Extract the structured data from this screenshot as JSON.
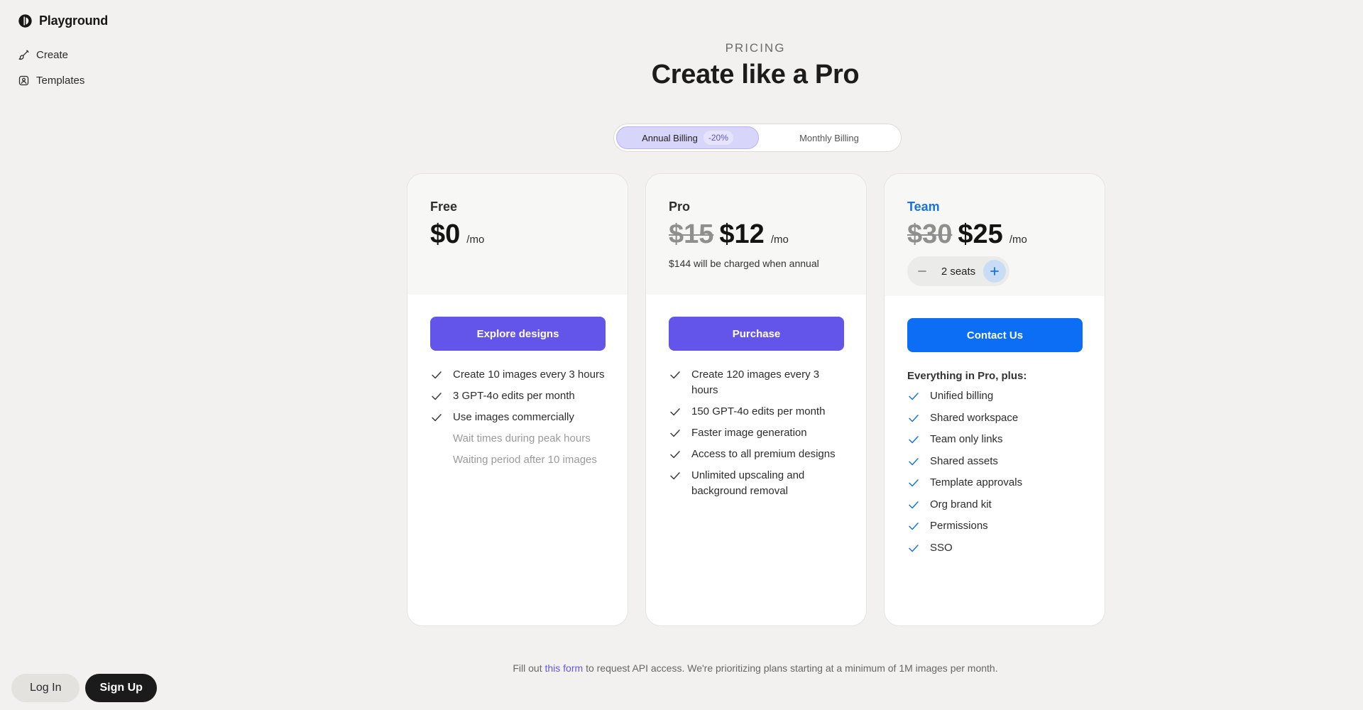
{
  "app": {
    "name": "Playground"
  },
  "sidebar": {
    "items": [
      {
        "label": "Create",
        "icon": "brush-icon"
      },
      {
        "label": "Templates",
        "icon": "templates-icon"
      }
    ],
    "auth": {
      "login_label": "Log In",
      "signup_label": "Sign Up"
    }
  },
  "header": {
    "eyebrow": "PRICING",
    "title": "Create like a Pro"
  },
  "billing": {
    "annual_label": "Annual Billing",
    "annual_discount": "-20%",
    "monthly_label": "Monthly Billing",
    "selected": "annual"
  },
  "plans": [
    {
      "name": "Free",
      "price": "$0",
      "per": "/mo",
      "cta": "Explore designs",
      "features": [
        {
          "text": "Create 10 images every 3 hours",
          "included": true
        },
        {
          "text": "3 GPT-4o edits per month",
          "included": true
        },
        {
          "text": "Use images commercially",
          "included": true
        },
        {
          "text": "Wait times during peak hours",
          "included": false
        },
        {
          "text": "Waiting period after 10 images",
          "included": false
        }
      ]
    },
    {
      "name": "Pro",
      "price_old": "$15",
      "price": "$12",
      "per": "/mo",
      "note": "$144 will be charged when annual",
      "cta": "Purchase",
      "features": [
        {
          "text": "Create 120 images every 3 hours",
          "included": true
        },
        {
          "text": "150 GPT-4o edits per month",
          "included": true
        },
        {
          "text": "Faster image generation",
          "included": true
        },
        {
          "text": "Access to all premium designs",
          "included": true
        },
        {
          "text": "Unlimited upscaling and background removal",
          "included": true
        }
      ]
    },
    {
      "name": "Team",
      "price_old": "$30",
      "price": "$25",
      "per": "/mo",
      "seats": "2 seats",
      "cta": "Contact Us",
      "intro": "Everything in Pro, plus:",
      "features": [
        {
          "text": "Unified billing",
          "included": true
        },
        {
          "text": "Shared workspace",
          "included": true
        },
        {
          "text": "Team only links",
          "included": true
        },
        {
          "text": "Shared assets",
          "included": true
        },
        {
          "text": "Template approvals",
          "included": true
        },
        {
          "text": "Org brand kit",
          "included": true
        },
        {
          "text": "Permissions",
          "included": true
        },
        {
          "text": "SSO",
          "included": true
        }
      ]
    }
  ],
  "footer": {
    "prefix": "Fill out",
    "link": "this form",
    "suffix": "to request API access. We're prioritizing plans starting at a minimum of 1M images per month."
  },
  "colors": {
    "background": "#f2f1ef",
    "accent_purple": "#6354ea",
    "accent_blue": "#0b6ef5",
    "team_name": "#1a73d9",
    "toggle_selected": "#d8d5fb"
  }
}
